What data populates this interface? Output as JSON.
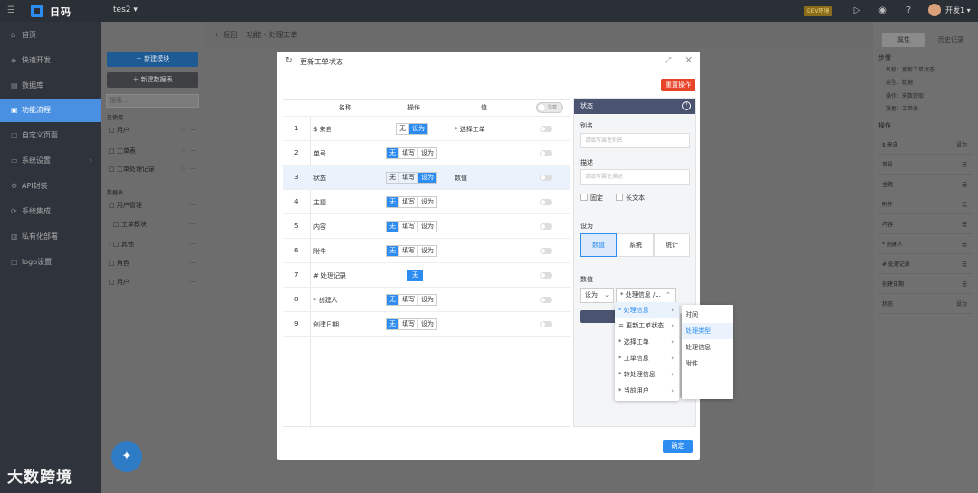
{
  "topbar": {
    "brand": "日码",
    "project": "tes2 ▾",
    "badge": "DEV环境",
    "user": "开发1 ▾"
  },
  "sidebar": {
    "items": [
      {
        "label": "首页",
        "icon": "home-icon"
      },
      {
        "label": "快速开发",
        "icon": "cube-icon"
      },
      {
        "label": "数据库",
        "icon": "database-icon"
      },
      {
        "label": "功能流程",
        "icon": "flow-icon"
      },
      {
        "label": "自定义页面",
        "icon": "page-icon"
      },
      {
        "label": "系统设置",
        "icon": "monitor-icon"
      },
      {
        "label": "API封装",
        "icon": "gear-icon"
      },
      {
        "label": "系统集成",
        "icon": "integration-icon"
      },
      {
        "label": "私有化部署",
        "icon": "deploy-icon"
      },
      {
        "label": "logo设置",
        "icon": "logo-icon"
      }
    ]
  },
  "panel2": {
    "new_module": "＋  新建模块",
    "new_table": "＋  新建数据表",
    "search_placeholder": "搜索...",
    "sec_used": "已使用",
    "used": [
      "用户",
      "工单表",
      "工单处理记录"
    ],
    "sec_tables": "数据表",
    "tables": [
      "用户管理",
      "工单模块",
      "其他",
      "角色",
      "用户"
    ]
  },
  "crumb": {
    "back": "返回",
    "path": "功能 - 处理工单"
  },
  "rpanel": {
    "tab_props": "属性",
    "tab_history": "历史记录",
    "step_h": "步骤",
    "step_lines": [
      "名称：更新工单状态",
      "类型：数据",
      "操作：来数获取",
      "数据：工单表"
    ],
    "ops_h": "操作",
    "ops": [
      [
        "$ 来自",
        "设为"
      ],
      [
        "单号",
        "无"
      ],
      [
        "主题",
        "无"
      ],
      [
        "附件",
        "无"
      ],
      [
        "内容",
        "无"
      ],
      [
        "* 创建人",
        "无"
      ],
      [
        "# 处理记录",
        "无"
      ],
      [
        "创建日期",
        "无"
      ],
      [
        "状态",
        "设为"
      ]
    ]
  },
  "modal": {
    "title": "更新工单状态",
    "reset": "重置操作",
    "ok": "确定",
    "cols": {
      "name": "名称",
      "op": "操作",
      "value": "值"
    },
    "header_toggle": "隐藏",
    "rows": [
      {
        "n": "1",
        "name": "$ 来自",
        "ops": [
          "无",
          "设为"
        ],
        "active": "设为",
        "value": "* 选择工单"
      },
      {
        "n": "2",
        "name": "单号",
        "ops": [
          "无",
          "填写",
          "设为"
        ],
        "active": "无",
        "value": ""
      },
      {
        "n": "3",
        "name": "状态",
        "ops": [
          "无",
          "填写",
          "设为"
        ],
        "active": "设为",
        "value": "数值"
      },
      {
        "n": "4",
        "name": "主题",
        "ops": [
          "无",
          "填写",
          "设为"
        ],
        "active": "无",
        "value": ""
      },
      {
        "n": "5",
        "name": "内容",
        "ops": [
          "无",
          "填写",
          "设为"
        ],
        "active": "无",
        "value": ""
      },
      {
        "n": "6",
        "name": "附件",
        "ops": [
          "无",
          "填写",
          "设为"
        ],
        "active": "无",
        "value": ""
      },
      {
        "n": "7",
        "name": "# 处理记录",
        "ops": [
          "无"
        ],
        "active": "无",
        "value": ""
      },
      {
        "n": "8",
        "name": "* 创建人",
        "ops": [
          "无",
          "填写",
          "设为"
        ],
        "active": "无",
        "value": ""
      },
      {
        "n": "9",
        "name": "创建日期",
        "ops": [
          "无",
          "填写",
          "设为"
        ],
        "active": "无",
        "value": ""
      }
    ]
  },
  "state": {
    "title": "状态",
    "alias_label": "别名",
    "alias_placeholder": "请填写属性别名",
    "desc_label": "描述",
    "desc_placeholder": "请填写属性描述",
    "fixed": "固定",
    "long_text": "长文本",
    "set_label": "设为",
    "set_opts": [
      "数值",
      "系统",
      "统计"
    ],
    "data_label": "数值",
    "dd1": "设为",
    "dd2": "* 处理信息 /..."
  },
  "cascader": {
    "level1": [
      "* 处理信息",
      "= 更新工单状态",
      "* 选择工单",
      "* 工单信息",
      "* 转处理信息",
      "* 当前用户"
    ],
    "level2": [
      "时间",
      "处理类型",
      "处理信息",
      "附件"
    ]
  },
  "watermark": "大数跨境",
  "colors": {
    "primary": "#2d8cf0",
    "danger": "#e8442a",
    "header": "#4a5470"
  }
}
